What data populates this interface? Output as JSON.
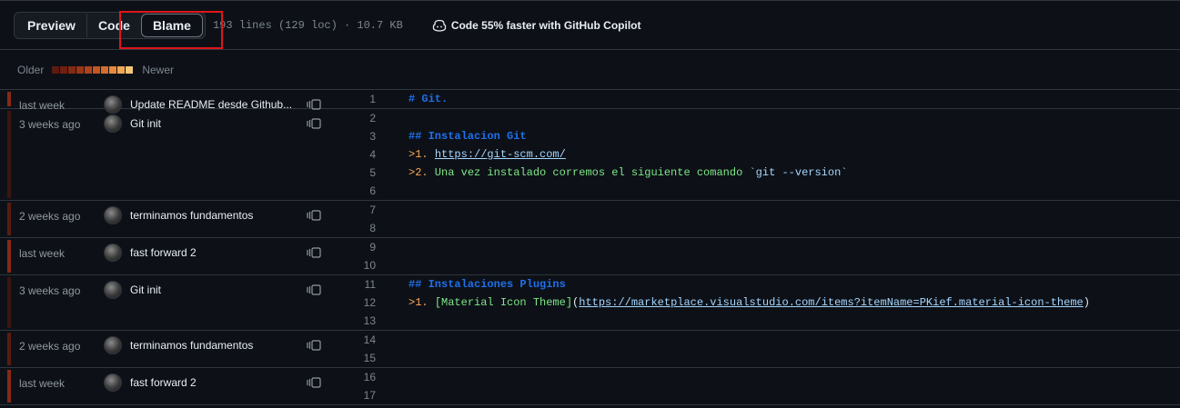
{
  "toolbar": {
    "tabs": [
      {
        "label": "Preview"
      },
      {
        "label": "Code"
      },
      {
        "label": "Blame"
      }
    ],
    "file_info": "193 lines (129 loc) · 10.7 KB",
    "copilot_text": "Code 55% faster with GitHub Copilot"
  },
  "legend": {
    "older": "Older",
    "newer": "Newer",
    "colors": [
      "#5c1b10",
      "#6f2012",
      "#842a14",
      "#9a3516",
      "#b0431a",
      "#c4561f",
      "#d66d2a",
      "#e68a3c",
      "#f0a857",
      "#f7c67a"
    ]
  },
  "hunks": [
    {
      "age": "last week",
      "message": "Update README desde Github...",
      "color": "#842a14",
      "lines": [
        "1"
      ]
    },
    {
      "age": "3 weeks ago",
      "message": "Git init",
      "color": "#3a1610",
      "lines": [
        "2",
        "3",
        "4",
        "5",
        "6"
      ]
    },
    {
      "age": "2 weeks ago",
      "message": "terminamos fundamentos",
      "color": "#5c1b10",
      "lines": [
        "7",
        "8"
      ]
    },
    {
      "age": "last week",
      "message": "fast forward 2",
      "color": "#842a14",
      "lines": [
        "9",
        "10"
      ]
    },
    {
      "age": "3 weeks ago",
      "message": "Git init",
      "color": "#3a1610",
      "lines": [
        "11",
        "12",
        "13"
      ]
    },
    {
      "age": "2 weeks ago",
      "message": "terminamos fundamentos",
      "color": "#5c1b10",
      "lines": [
        "14",
        "15"
      ]
    },
    {
      "age": "last week",
      "message": "fast forward 2",
      "color": "#842a14",
      "lines": [
        "16",
        "17"
      ]
    }
  ],
  "code": {
    "l1": "# Git.",
    "l3": "## Instalacion Git",
    "l4_num": "1.",
    "l4_url": "https://git-scm.com/",
    "l5_num": "2.",
    "l5_text": " Una vez instalado corremos el siguiente comando ",
    "l5_code": "`git --version`",
    "l11": "## Instalaciones Plugins",
    "l12_num": "1.",
    "l12_link": "[Material Icon Theme]",
    "l12_url": "https://marketplace.visualstudio.com/items?itemName=PKief.material-icon-theme",
    "gt": ">",
    "paren_open": "(",
    "paren_close": ")"
  }
}
